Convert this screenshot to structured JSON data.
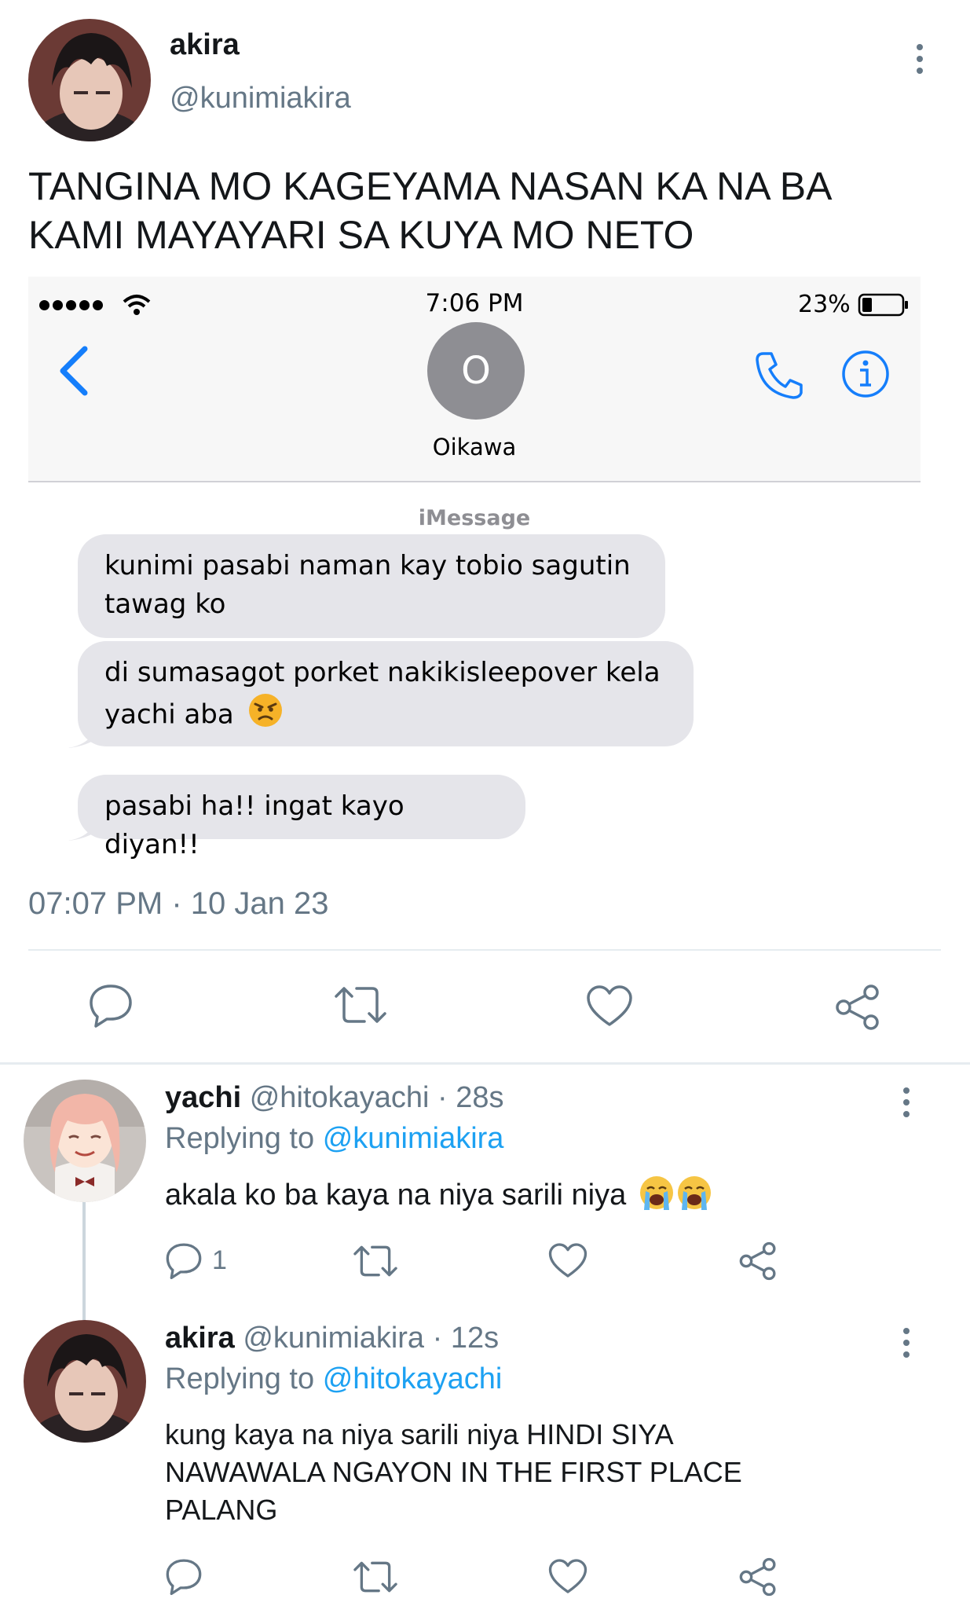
{
  "tweet": {
    "author": {
      "name": "akira",
      "handle": "@kunimiakira"
    },
    "text_line1": "TANGINA MO KAGEYAMA NASAN KA NA BA",
    "text_line2": "KAMI MAYAYARI SA KUYA MO NETO",
    "timestamp": "07:07 PM · 10 Jan 23"
  },
  "screenshot": {
    "status_time": "7:06 PM",
    "battery": "23%",
    "contact_initial": "O",
    "contact_name": "Oikawa",
    "service_label": "iMessage",
    "messages": [
      {
        "line1": "kunimi pasabi naman kay tobio sagutin",
        "line2": "tawag ko"
      },
      {
        "line1": "di sumasagot porket nakikisleepover kela",
        "line2": "yachi aba",
        "emoji": "angry-face"
      },
      {
        "line1": "pasabi ha!! ingat kayo diyan!!"
      }
    ]
  },
  "replies": [
    {
      "name": "yachi",
      "handle": "@hitokayachi",
      "time": "· 28s",
      "replying_label": "Replying to",
      "replying_to": "@kunimiakira",
      "text": "akala ko ba kaya na niya sarili niya",
      "emoji": "loudly-crying-face",
      "reply_count": "1"
    },
    {
      "name": "akira",
      "handle": "@kunimiakira",
      "time": "· 12s",
      "replying_label": "Replying to",
      "replying_to": "@hitokayachi",
      "text_line1": "kung kaya na niya sarili niya HINDI SIYA",
      "text_line2": "NAWAWALA NGAYON IN THE FIRST PLACE",
      "text_line3": "PALANG"
    }
  ],
  "colors": {
    "link": "#1da1f2",
    "muted": "#657786",
    "ios_blue": "#157efb",
    "bubble": "#e5e5ea"
  },
  "icons": [
    "reply-icon",
    "retweet-icon",
    "like-icon",
    "share-icon",
    "more-icon",
    "back-chevron-icon",
    "phone-icon",
    "info-icon",
    "wifi-icon",
    "battery-icon"
  ]
}
